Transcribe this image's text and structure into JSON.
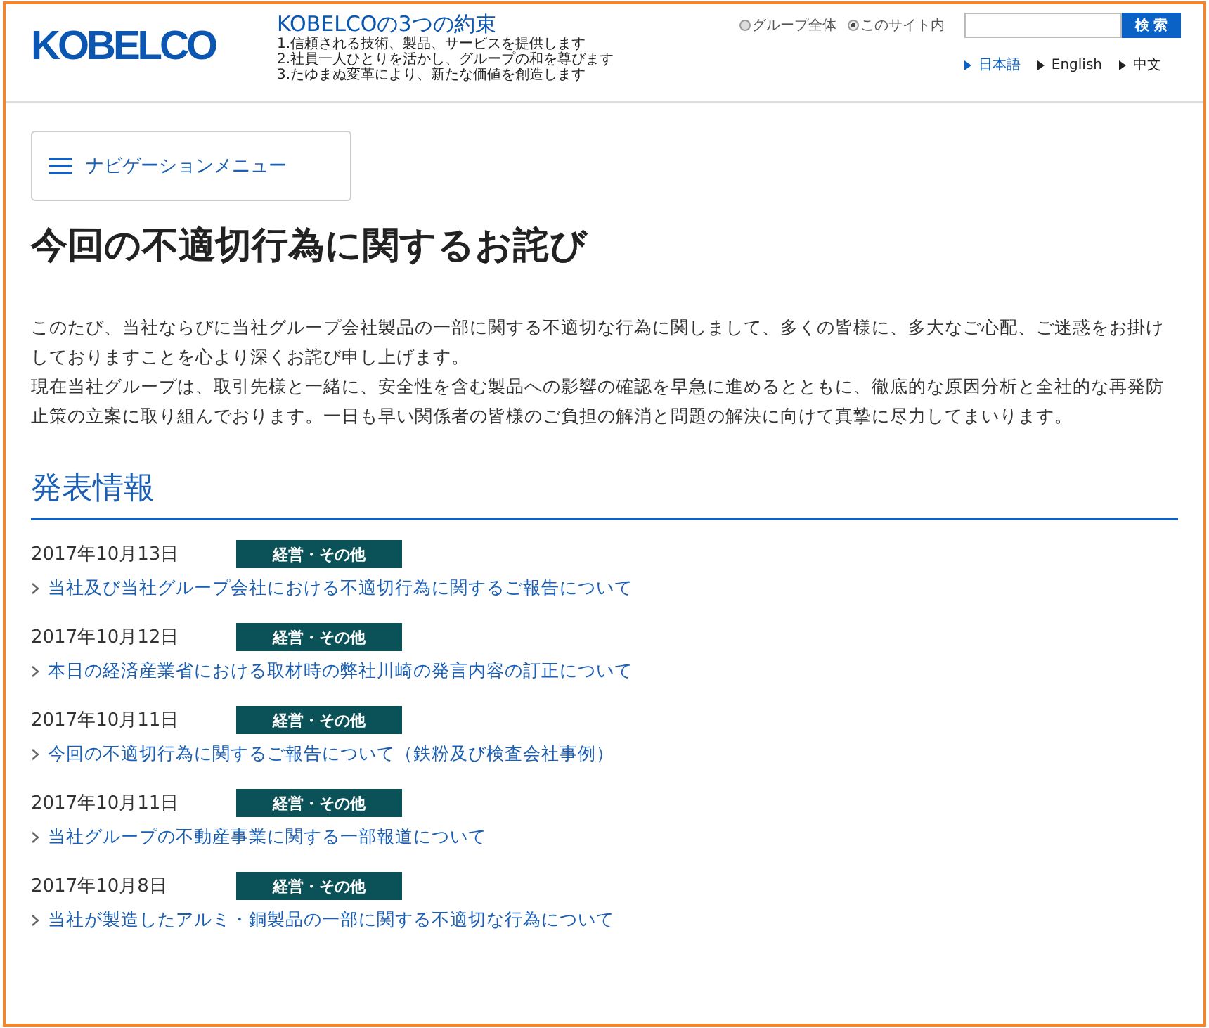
{
  "header": {
    "logo": "KOBELCO",
    "promise_title": "KOBELCOの3つの約束",
    "promises": [
      "1.信頼される技術、製品、サービスを提供します",
      "2.社員一人ひとりを活かし、グループの和を尊びます",
      "3.たゆまぬ変革により、新たな価値を創造します"
    ],
    "scopes": [
      {
        "label": "グループ全体",
        "selected": false
      },
      {
        "label": "このサイト内",
        "selected": true
      }
    ],
    "search_button": "検 索",
    "languages": [
      {
        "label": "日本語",
        "selected": true
      },
      {
        "label": "English",
        "selected": false
      },
      {
        "label": "中文",
        "selected": false
      }
    ]
  },
  "nav_menu": "ナビゲーションメニュー",
  "title": "今回の不適切行為に関するお詫び",
  "paragraphs": [
    "このたび、当社ならびに当社グループ会社製品の一部に関する不適切な行為に関しまして、多くの皆様に、多大なご心配、ご迷惑をお掛けしておりますことを心より深くお詫び申し上げます。",
    "現在当社グループは、取引先様と一緒に、安全性を含む製品への影響の確認を早急に進めるとともに、徹底的な原因分析と全社的な再発防止策の立案に取り組んでおります。一日も早い関係者の皆様のご負担の解消と問題の解決に向けて真摯に尽力してまいります。"
  ],
  "section_title": "発表情報",
  "news": [
    {
      "date": "2017年10月13日",
      "tag": "経営・その他",
      "title": "当社及び当社グループ会社における不適切行為に関するご報告について"
    },
    {
      "date": "2017年10月12日",
      "tag": "経営・その他",
      "title": "本日の経済産業省における取材時の弊社川崎の発言内容の訂正について"
    },
    {
      "date": "2017年10月11日",
      "tag": "経営・その他",
      "title": "今回の不適切行為に関するご報告について（鉄粉及び検査会社事例）"
    },
    {
      "date": "2017年10月11日",
      "tag": "経営・その他",
      "title": "当社グループの不動産事業に関する一部報道について"
    },
    {
      "date": "2017年10月8日",
      "tag": "経営・その他",
      "title": "当社が製造したアルミ・銅製品の一部に関する不適切な行為について"
    }
  ]
}
